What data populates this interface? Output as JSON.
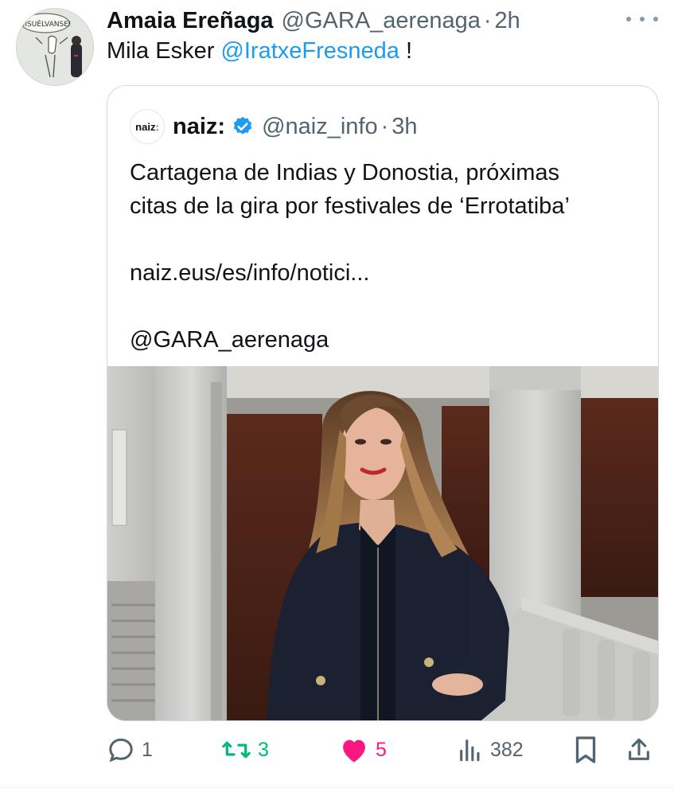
{
  "colors": {
    "accent": "#1d9bf0",
    "retweet": "#00ba7c",
    "like": "#f91880",
    "muted": "#536471",
    "verified": "#1d9bf0"
  },
  "tweet": {
    "author_name": "Amaia Ereñaga",
    "author_handle": "@GARA_aerenaga",
    "separator": "·",
    "time": "2h",
    "avatar_sign_text": "DISUÉLVANSE!",
    "text_prefix": "Mila Esker ",
    "mention": "@IratxeFresneda",
    "text_suffix": " !",
    "more_icon": "more-dots-icon"
  },
  "quote": {
    "avatar_text_main": "naiz",
    "avatar_text_colon": ":",
    "name": "naiz:",
    "verified_icon": "verified-badge-icon",
    "handle": "@naiz_info",
    "separator": "·",
    "time": "3h",
    "body_line1": "Cartagena de Indias y Donostia, próximas",
    "body_line2": "citas de la gira por festivales de ‘Errotatiba’",
    "link": "naiz.eus/es/info/notici...",
    "credit": "@GARA_aerenaga"
  },
  "actions": {
    "reply_count": "1",
    "retweet_count": "3",
    "like_count": "5",
    "views_count": "382"
  }
}
